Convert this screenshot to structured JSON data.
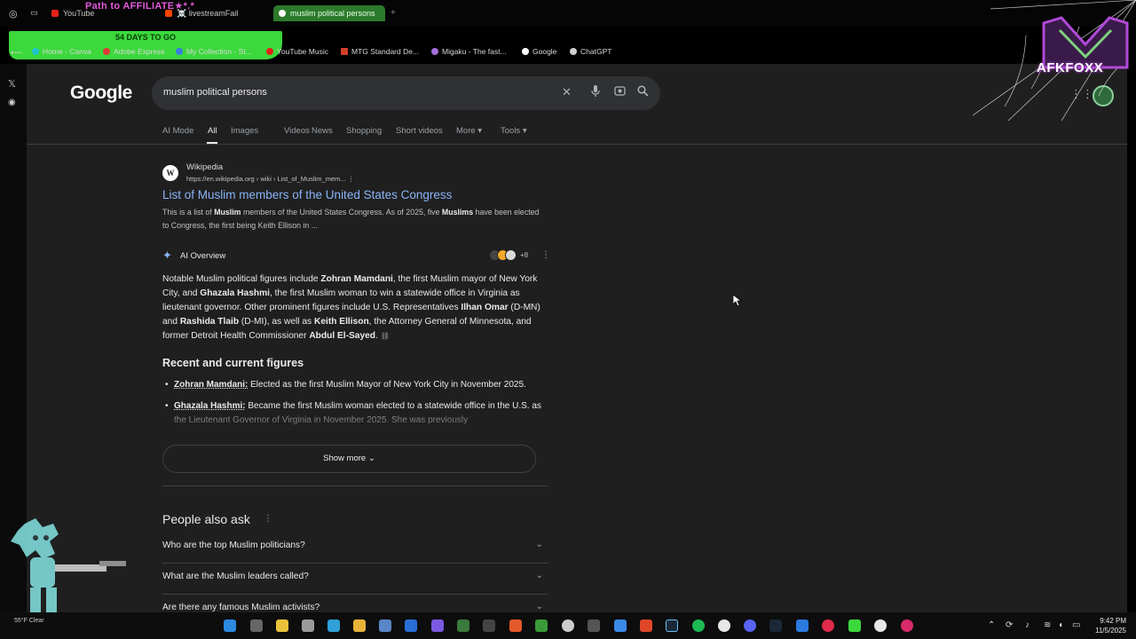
{
  "browser": {
    "tabs": [
      "YouTube",
      "☠️ livestreamFail",
      "muslim political persons"
    ],
    "affiliate_banner": "Path to AFFILIATE",
    "days_banner": "54 DAYS TO GO",
    "bookmarks": [
      "Home - Canva",
      "Adobe Express",
      "My Collection - St...",
      "YouTube Music",
      "MTG Standard De...",
      "Migaku - The fast...",
      "Google",
      "ChatGPT"
    ]
  },
  "google": {
    "logo": "Google",
    "query": "muslim political persons",
    "tabs": [
      "AI Mode",
      "All",
      "Images",
      "Videos",
      "News",
      "Shopping",
      "Short videos",
      "More",
      "Tools"
    ]
  },
  "result": {
    "favicon": "W",
    "site": "Wikipedia",
    "url": "https://en.wikipedia.org › wiki › List_of_Muslim_mem...",
    "title": "List of Muslim members of the United States Congress",
    "snippet": {
      "p1": "This is a list of ",
      "b1": "Muslim",
      "p2": " members of the United States Congress. As of 2025, five ",
      "b2": "Muslims",
      "p3": " have been elected to Congress, the first being Keith Ellison in ..."
    }
  },
  "ai_overview": {
    "label": "AI Overview",
    "sources_count": "+8",
    "text": {
      "t1": "Notable Muslim political figures include ",
      "b1": "Zohran Mamdani",
      "t2": ", the first Muslim mayor of New York City, and ",
      "b2": "Ghazala Hashmi",
      "t3": ", the first Muslim woman to win a statewide office in Virginia as lieutenant governor. Other prominent figures include U.S. Representatives ",
      "b3": "Ilhan Omar",
      "t4": " (D-MN) and ",
      "b4": "Rashida Tlaib",
      "t5": " (D-MI), as well as ",
      "b5": "Keith Ellison",
      "t6": ", the Attorney General of Minnesota, and former Detroit Health Commissioner ",
      "b6": "Abdul El-Sayed",
      "t7": "."
    },
    "recent_heading": "Recent and current figures",
    "recent": [
      {
        "name": "Zohran Mamdani:",
        "text": " Elected as the first Muslim Mayor of New York City in November 2025."
      },
      {
        "name": "Ghazala Hashmi:",
        "text": " Became the first Muslim woman elected to a statewide office in the U.S. as the Lieutenant Governor of Virginia in November 2025. She was previously"
      }
    ],
    "show_more": "Show more"
  },
  "people_also_ask": {
    "heading": "People also ask",
    "questions": [
      "Who are the top Muslim politicians?",
      "What are the Muslim leaders called?",
      "Are there any famous Muslim activists?"
    ]
  },
  "overlay": {
    "brand": "AFKFOXX"
  },
  "taskbar": {
    "time": "9:42 PM",
    "date": "11/5/2025",
    "weather": "55°F Clear"
  },
  "colors": {
    "page_bg": "#1f1f1f",
    "link": "#8ab4f8",
    "text": "#e8eaed",
    "active_tab": "#2c7a2c",
    "slime": "#3cd83c"
  }
}
